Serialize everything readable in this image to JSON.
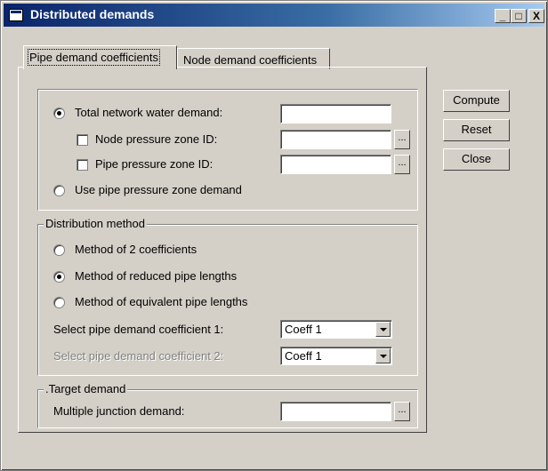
{
  "window": {
    "title": "Distributed demands",
    "minimize_label": "_",
    "maximize_label": "□",
    "close_label": "X"
  },
  "tabs": [
    {
      "label": "Pipe demand coefficients",
      "active": true
    },
    {
      "label": "Node demand coefficients",
      "active": false
    }
  ],
  "demand_source": {
    "total_label": "Total network water demand:",
    "total_value": "",
    "total_selected": true,
    "node_zone_label": "Node pressure zone ID:",
    "node_zone_value": "",
    "node_zone_checked": false,
    "pipe_zone_label": "Pipe pressure zone ID:",
    "pipe_zone_value": "",
    "pipe_zone_checked": false,
    "use_pipe_zone_label": "Use pipe pressure zone demand",
    "use_pipe_zone_selected": false,
    "browse_label": "..."
  },
  "distribution": {
    "legend": "Distribution method",
    "methods": [
      {
        "label": "Method of 2 coefficients",
        "selected": false
      },
      {
        "label": "Method of reduced pipe lengths",
        "selected": true
      },
      {
        "label": "Method of equivalent pipe lengths",
        "selected": false
      }
    ],
    "coeff1_label": "Select pipe demand coefficient 1:",
    "coeff1_value": "Coeff 1",
    "coeff2_label": "Select pipe demand coefficient 2:",
    "coeff2_value": "Coeff 1"
  },
  "target": {
    "legend": ".Target demand",
    "junction_label": "Multiple junction demand:",
    "junction_value": "",
    "browse_label": "..."
  },
  "buttons": {
    "compute": "Compute",
    "reset": "Reset",
    "close": "Close"
  }
}
